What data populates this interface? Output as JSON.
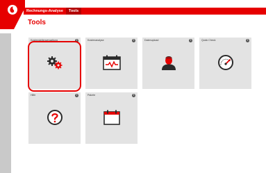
{
  "header": {
    "breadcrumbs": [
      "Rechnungs-Analyse",
      "Tools"
    ]
  },
  "page": {
    "title": "Tools"
  },
  "tiles": [
    {
      "label": "Kostenstellenverwaltung",
      "icon": "gears-icon",
      "info": "?"
    },
    {
      "label": "Kostenanalyse",
      "icon": "calendar-chart-icon",
      "info": "?"
    },
    {
      "label": "Datenupload",
      "icon": "user-icon",
      "info": "?"
    },
    {
      "label": "Quick Check",
      "icon": "speedometer-icon",
      "info": "?"
    },
    {
      "label": "Hilfe",
      "icon": "question-icon",
      "info": "?"
    },
    {
      "label": "Pakete",
      "icon": "calendar-icon",
      "info": "?"
    }
  ],
  "colors": {
    "brand": "#e60000",
    "tile": "#e3e3e3",
    "rail": "#c9c9c9"
  }
}
